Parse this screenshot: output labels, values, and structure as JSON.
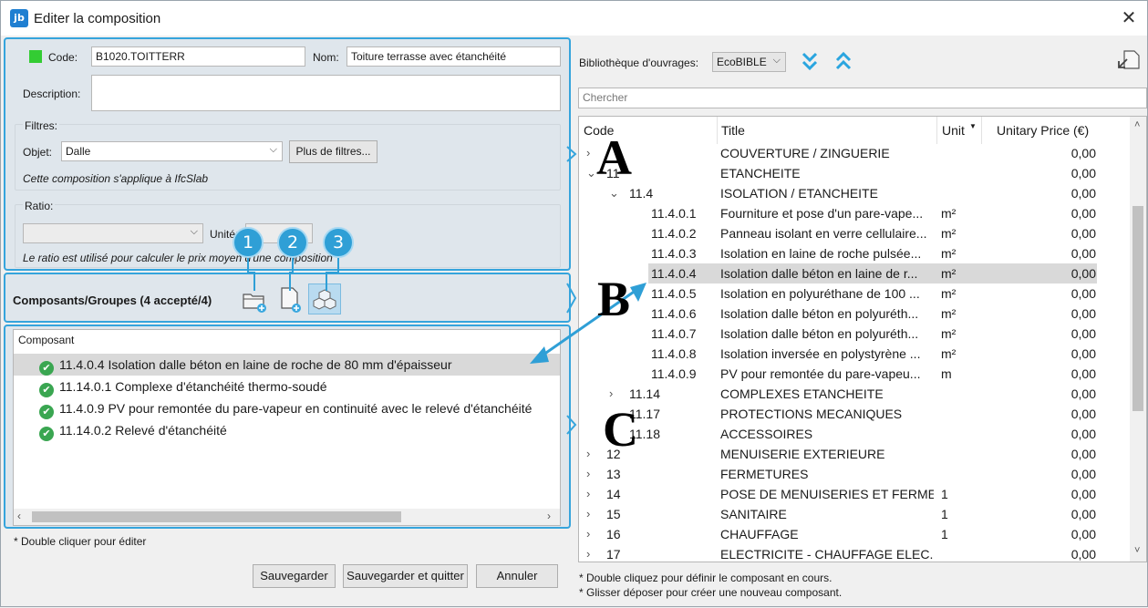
{
  "window": {
    "title": "Editer la composition",
    "app_icon": "jb",
    "close_glyph": "✕"
  },
  "form": {
    "code_label": "Code:",
    "code_value": "B1020.TOITTERR",
    "name_label": "Nom:",
    "name_value": "Toiture terrasse avec étanchéité",
    "description_label": "Description:",
    "description_value": "",
    "status_color": "#33cc33"
  },
  "filters": {
    "title": "Filtres:",
    "object_label": "Objet:",
    "object_value": "Dalle",
    "more_button": "Plus de filtres...",
    "applies_text": "Cette composition s'applique à IfcSlab"
  },
  "ratio": {
    "title": "Ratio:",
    "select_value": "",
    "unit_label": "Unité:",
    "unit_value": "",
    "note": "Le ratio est utilisé pour calculer le prix moyen d'une composition"
  },
  "components": {
    "header": "Composants/Groupes",
    "count": "(4 accepté/4)",
    "column_title": "Composant",
    "items": [
      "11.4.0.4 Isolation dalle béton en laine de roche de 80 mm d'épaisseur",
      "11.14.0.1 Complexe d'étanchéité thermo-soudé",
      "11.4.0.9 PV pour remontée du pare-vapeur en continuité avec le relevé d'étanchéité",
      "11.14.0.2 Relevé d'étanchéité"
    ],
    "footnote": "* Double cliquer pour éditer"
  },
  "badges": [
    "1",
    "2",
    "3"
  ],
  "annotations": [
    "A",
    "B",
    "C"
  ],
  "buttons": {
    "save": "Sauvegarder",
    "save_quit": "Sauvegarder et quitter",
    "cancel": "Annuler"
  },
  "library": {
    "label": "Bibliothèque d'ouvrages:",
    "value": "EcoBIBLE",
    "search_placeholder": "Chercher",
    "columns": {
      "code": "Code",
      "title": "Title",
      "unit": "Unit",
      "price": "Unitary Price (€)"
    },
    "rows": [
      {
        "chev": "›",
        "code": "",
        "title": "COUVERTURE / ZINGUERIE",
        "unit": "",
        "price": "0,00",
        "indent": 0
      },
      {
        "chev": "⌄",
        "code": "11",
        "title": "ETANCHEITE",
        "unit": "",
        "price": "0,00",
        "indent": 0
      },
      {
        "chev": "⌄",
        "code": "11.4",
        "title": "ISOLATION / ETANCHEITE",
        "unit": "",
        "price": "0,00",
        "indent": 1
      },
      {
        "chev": "",
        "code": "11.4.0.1",
        "title": "Fourniture et pose d'un pare-vape...",
        "unit": "m²",
        "price": "0,00",
        "indent": 2
      },
      {
        "chev": "",
        "code": "11.4.0.2",
        "title": "Panneau isolant en verre cellulaire...",
        "unit": "m²",
        "price": "0,00",
        "indent": 2
      },
      {
        "chev": "",
        "code": "11.4.0.3",
        "title": "Isolation en laine de roche pulsée...",
        "unit": "m²",
        "price": "0,00",
        "indent": 2
      },
      {
        "chev": "",
        "code": "11.4.0.4",
        "title": "Isolation dalle béton en laine de r...",
        "unit": "m²",
        "price": "0,00",
        "indent": 2,
        "selected": true
      },
      {
        "chev": "",
        "code": "11.4.0.5",
        "title": "Isolation en polyuréthane de 100 ...",
        "unit": "m²",
        "price": "0,00",
        "indent": 2
      },
      {
        "chev": "",
        "code": "11.4.0.6",
        "title": "Isolation dalle béton en polyuréth...",
        "unit": "m²",
        "price": "0,00",
        "indent": 2
      },
      {
        "chev": "",
        "code": "11.4.0.7",
        "title": "Isolation dalle béton en polyuréth...",
        "unit": "m²",
        "price": "0,00",
        "indent": 2
      },
      {
        "chev": "",
        "code": "11.4.0.8",
        "title": "Isolation inversée en polystyrène ...",
        "unit": "m²",
        "price": "0,00",
        "indent": 2
      },
      {
        "chev": "",
        "code": "11.4.0.9",
        "title": "PV pour remontée du pare-vapeu...",
        "unit": "m",
        "price": "0,00",
        "indent": 2
      },
      {
        "chev": "›",
        "code": "11.14",
        "title": "COMPLEXES ETANCHEITE",
        "unit": "",
        "price": "0,00",
        "indent": 1
      },
      {
        "chev": "",
        "code": "11.17",
        "title": "PROTECTIONS MECANIQUES",
        "unit": "",
        "price": "0,00",
        "indent": 1
      },
      {
        "chev": "",
        "code": "11.18",
        "title": "ACCESSOIRES",
        "unit": "",
        "price": "0,00",
        "indent": 1
      },
      {
        "chev": "›",
        "code": "12",
        "title": "MENUISERIE EXTERIEURE",
        "unit": "",
        "price": "0,00",
        "indent": 0
      },
      {
        "chev": "›",
        "code": "13",
        "title": "FERMETURES",
        "unit": "",
        "price": "0,00",
        "indent": 0
      },
      {
        "chev": "›",
        "code": "14",
        "title": "POSE DE MENUISERIES ET FERME...",
        "unit": "1",
        "price": "0,00",
        "indent": 0
      },
      {
        "chev": "›",
        "code": "15",
        "title": "SANITAIRE",
        "unit": "1",
        "price": "0,00",
        "indent": 0
      },
      {
        "chev": "›",
        "code": "16",
        "title": "CHAUFFAGE",
        "unit": "1",
        "price": "0,00",
        "indent": 0
      },
      {
        "chev": "›",
        "code": "17",
        "title": "ELECTRICITE - CHAUFFAGE ELEC.",
        "unit": "",
        "price": "0,00",
        "indent": 0
      }
    ],
    "note1": "* Double cliquez pour définir le composant en cours.",
    "note2": "* Glisser déposer pour créer une nouveau composant."
  },
  "colors": {
    "accent": "#35a4dc",
    "panel": "#dfe6ec",
    "selected": "#d9d9d9",
    "check": "#3aa651"
  }
}
